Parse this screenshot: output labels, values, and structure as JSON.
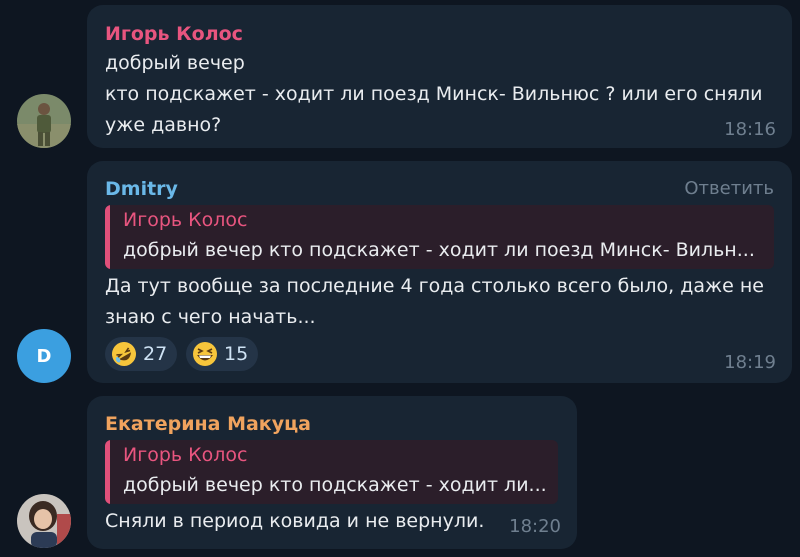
{
  "messages": [
    {
      "author": "Игорь Колос",
      "author_color": "#e8557f",
      "lines": [
        "добрый вечер",
        "кто подскажет - ходит ли поезд Минск- Вильнюс ? или его сняли",
        "уже давно?"
      ],
      "time": "18:16"
    },
    {
      "author": "Dmitry",
      "author_color": "#6ab8e8",
      "avatar_letter": "D",
      "reply_label": "Ответить",
      "quote": {
        "author": "Игорь Колос",
        "text": "добрый вечер  кто подскажет - ходит ли поезд Минск- Вильн..."
      },
      "lines": [
        "Да тут вообще за последние 4 года столько всего было, даже не",
        "знаю с чего начать..."
      ],
      "reactions": [
        {
          "emoji": "rolling-on-floor-laughing",
          "count": "27"
        },
        {
          "emoji": "grinning-squinting-face",
          "count": "15"
        }
      ],
      "time": "18:19"
    },
    {
      "author": "Екатерина Макуца",
      "author_color": "#f0a35e",
      "quote": {
        "author": "Игорь Колос",
        "text": "добрый вечер  кто подскажет - ходит ли..."
      },
      "lines": [
        "Сняли в период ковида и не вернули."
      ],
      "time": "18:20"
    }
  ]
}
